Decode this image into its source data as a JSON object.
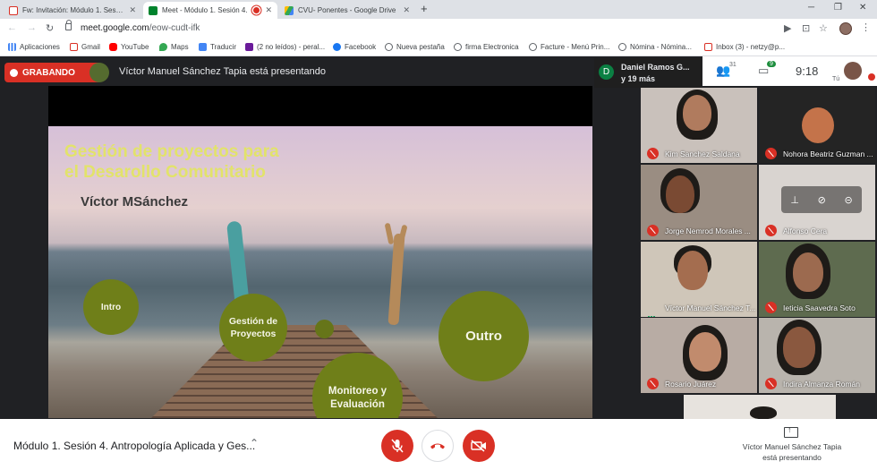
{
  "browser": {
    "tabs": [
      {
        "title": "Fw: Invitación: Módulo 1. Sesión",
        "active": false
      },
      {
        "title": "Meet - Módulo 1. Sesión 4.",
        "active": true
      },
      {
        "title": "CVU- Ponentes - Google Drive",
        "active": false
      }
    ],
    "newtab_symbol": "+",
    "url_host": "meet.google.com",
    "url_path": "/eow-cudt-ifk",
    "bookmarks": [
      "Aplicaciones",
      "Gmail",
      "YouTube",
      "Maps",
      "Traducir",
      "(2 no leídos) - peral...",
      "Facebook",
      "Nueva pestaña",
      "firma Electronica",
      "Facture - Menú Prin...",
      "Nómina - Nómina...",
      "Inbox (3) - netzy@p..."
    ]
  },
  "meet": {
    "recording_label": "GRABANDO",
    "presenting_title": "Víctor Manuel Sánchez Tapia está presentando",
    "participants_chip": {
      "initial": "D",
      "line1": "Daniel Ramos G...",
      "line2": "y 19 más"
    },
    "people_count": "31",
    "chat_count": "9",
    "time": "9:18",
    "self_label": "Tú",
    "slide": {
      "title_line1": "Gestión de proyectos para",
      "title_line2": "el Desarollo Comunitario",
      "author": "Víctor MSánchez",
      "circles": [
        "Intro",
        "Gestión de Proyectos",
        "Monitoreo y Evaluación",
        "Outro"
      ]
    },
    "participants": [
      "Kim Sanchez Saldana",
      "Nohora Beatriz Guzman ...",
      "Jorge Nemrod Morales ...",
      "Alfonso Cera",
      "Víctor Manuel Sánchez T...",
      "Ieticia Saavedra Soto",
      "Rosario Juárez",
      "Indira Almanza Román"
    ]
  },
  "bottom_bar": {
    "meeting_title": "Módulo 1. Sesión 4. Antropología Aplicada y Ges...",
    "present_label_line1": "Víctor Manuel Sánchez Tapia",
    "present_label_line2": "está presentando"
  },
  "colors": {
    "recording": "#d93025",
    "slide_title": "#e2e36a",
    "circle": "#6f7f19"
  }
}
